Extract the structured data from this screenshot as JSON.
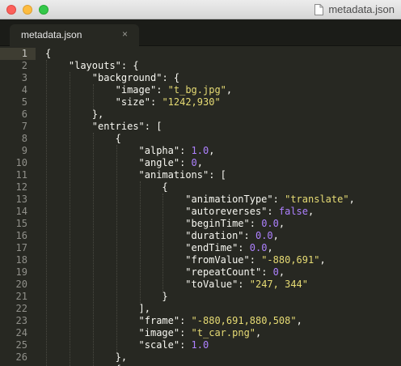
{
  "window": {
    "title": "metadata.json"
  },
  "tabs": [
    {
      "label": "metadata.json",
      "close_glyph": "×"
    }
  ],
  "editor": {
    "current_line": 1,
    "lines": [
      {
        "n": "1",
        "indent": 0,
        "tokens": [
          {
            "t": "{",
            "c": "p"
          }
        ]
      },
      {
        "n": "2",
        "indent": 1,
        "tokens": [
          {
            "t": "\"layouts\"",
            "c": "p"
          },
          {
            "t": ": {",
            "c": "p"
          }
        ]
      },
      {
        "n": "3",
        "indent": 2,
        "tokens": [
          {
            "t": "\"background\"",
            "c": "p"
          },
          {
            "t": ": {",
            "c": "p"
          }
        ]
      },
      {
        "n": "4",
        "indent": 3,
        "tokens": [
          {
            "t": "\"image\"",
            "c": "p"
          },
          {
            "t": ": ",
            "c": "p"
          },
          {
            "t": "\"t_bg.jpg\"",
            "c": "s"
          },
          {
            "t": ",",
            "c": "p"
          }
        ]
      },
      {
        "n": "5",
        "indent": 3,
        "tokens": [
          {
            "t": "\"size\"",
            "c": "p"
          },
          {
            "t": ": ",
            "c": "p"
          },
          {
            "t": "\"1242,930\"",
            "c": "s"
          }
        ]
      },
      {
        "n": "6",
        "indent": 2,
        "tokens": [
          {
            "t": "},",
            "c": "p"
          }
        ]
      },
      {
        "n": "7",
        "indent": 2,
        "tokens": [
          {
            "t": "\"entries\"",
            "c": "p"
          },
          {
            "t": ": [",
            "c": "p"
          }
        ]
      },
      {
        "n": "8",
        "indent": 3,
        "tokens": [
          {
            "t": "{",
            "c": "p"
          }
        ]
      },
      {
        "n": "9",
        "indent": 4,
        "tokens": [
          {
            "t": "\"alpha\"",
            "c": "p"
          },
          {
            "t": ": ",
            "c": "p"
          },
          {
            "t": "1.0",
            "c": "n"
          },
          {
            "t": ",",
            "c": "p"
          }
        ]
      },
      {
        "n": "10",
        "indent": 4,
        "tokens": [
          {
            "t": "\"angle\"",
            "c": "p"
          },
          {
            "t": ": ",
            "c": "p"
          },
          {
            "t": "0",
            "c": "n"
          },
          {
            "t": ",",
            "c": "p"
          }
        ]
      },
      {
        "n": "11",
        "indent": 4,
        "tokens": [
          {
            "t": "\"animations\"",
            "c": "p"
          },
          {
            "t": ": [",
            "c": "p"
          }
        ]
      },
      {
        "n": "12",
        "indent": 5,
        "tokens": [
          {
            "t": "{",
            "c": "p"
          }
        ]
      },
      {
        "n": "13",
        "indent": 6,
        "tokens": [
          {
            "t": "\"animationType\"",
            "c": "p"
          },
          {
            "t": ": ",
            "c": "p"
          },
          {
            "t": "\"translate\"",
            "c": "s"
          },
          {
            "t": ",",
            "c": "p"
          }
        ]
      },
      {
        "n": "14",
        "indent": 6,
        "tokens": [
          {
            "t": "\"autoreverses\"",
            "c": "p"
          },
          {
            "t": ": ",
            "c": "p"
          },
          {
            "t": "false",
            "c": "k"
          },
          {
            "t": ",",
            "c": "p"
          }
        ]
      },
      {
        "n": "15",
        "indent": 6,
        "tokens": [
          {
            "t": "\"beginTime\"",
            "c": "p"
          },
          {
            "t": ": ",
            "c": "p"
          },
          {
            "t": "0.0",
            "c": "n"
          },
          {
            "t": ",",
            "c": "p"
          }
        ]
      },
      {
        "n": "16",
        "indent": 6,
        "tokens": [
          {
            "t": "\"duration\"",
            "c": "p"
          },
          {
            "t": ": ",
            "c": "p"
          },
          {
            "t": "0.0",
            "c": "n"
          },
          {
            "t": ",",
            "c": "p"
          }
        ]
      },
      {
        "n": "17",
        "indent": 6,
        "tokens": [
          {
            "t": "\"endTime\"",
            "c": "p"
          },
          {
            "t": ": ",
            "c": "p"
          },
          {
            "t": "0.0",
            "c": "n"
          },
          {
            "t": ",",
            "c": "p"
          }
        ]
      },
      {
        "n": "18",
        "indent": 6,
        "tokens": [
          {
            "t": "\"fromValue\"",
            "c": "p"
          },
          {
            "t": ": ",
            "c": "p"
          },
          {
            "t": "\"-880,691\"",
            "c": "s"
          },
          {
            "t": ",",
            "c": "p"
          }
        ]
      },
      {
        "n": "19",
        "indent": 6,
        "tokens": [
          {
            "t": "\"repeatCount\"",
            "c": "p"
          },
          {
            "t": ": ",
            "c": "p"
          },
          {
            "t": "0",
            "c": "n"
          },
          {
            "t": ",",
            "c": "p"
          }
        ]
      },
      {
        "n": "20",
        "indent": 6,
        "tokens": [
          {
            "t": "\"toValue\"",
            "c": "p"
          },
          {
            "t": ": ",
            "c": "p"
          },
          {
            "t": "\"247, 344\"",
            "c": "s"
          }
        ]
      },
      {
        "n": "21",
        "indent": 5,
        "tokens": [
          {
            "t": "}",
            "c": "p"
          }
        ]
      },
      {
        "n": "22",
        "indent": 4,
        "tokens": [
          {
            "t": "],",
            "c": "p"
          }
        ]
      },
      {
        "n": "23",
        "indent": 4,
        "tokens": [
          {
            "t": "\"frame\"",
            "c": "p"
          },
          {
            "t": ": ",
            "c": "p"
          },
          {
            "t": "\"-880,691,880,508\"",
            "c": "s"
          },
          {
            "t": ",",
            "c": "p"
          }
        ]
      },
      {
        "n": "24",
        "indent": 4,
        "tokens": [
          {
            "t": "\"image\"",
            "c": "p"
          },
          {
            "t": ": ",
            "c": "p"
          },
          {
            "t": "\"t_car.png\"",
            "c": "s"
          },
          {
            "t": ",",
            "c": "p"
          }
        ]
      },
      {
        "n": "25",
        "indent": 4,
        "tokens": [
          {
            "t": "\"scale\"",
            "c": "p"
          },
          {
            "t": ": ",
            "c": "p"
          },
          {
            "t": "1.0",
            "c": "n"
          }
        ]
      },
      {
        "n": "26",
        "indent": 3,
        "tokens": [
          {
            "t": "},",
            "c": "p"
          }
        ]
      },
      {
        "n": "",
        "indent": 3,
        "tokens": [
          {
            "t": "{",
            "c": "p"
          }
        ]
      }
    ]
  },
  "colors": {
    "background": "#272822",
    "text": "#f8f8f2",
    "string": "#e6db74",
    "number": "#ae81ff",
    "gutter_text": "#90908a"
  }
}
